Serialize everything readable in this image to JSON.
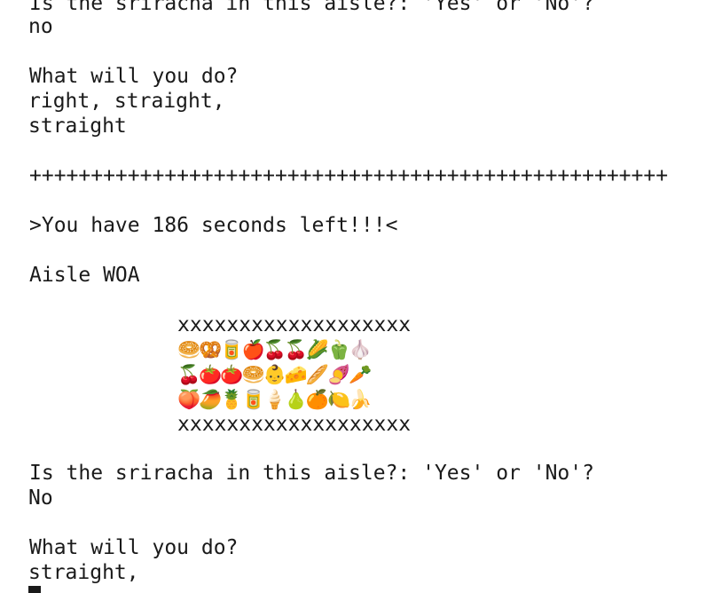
{
  "terminal": {
    "lines": {
      "prompt_prev": "Is the sriracha in this aisle?: 'Yes' or 'No'?",
      "answer_prev": "no",
      "ask_prev": "What will you do?",
      "move_prev_1": "right, straight,",
      "move_prev_2": "straight",
      "separator": "++++++++++++++++++++++++++++++++++++++++++++++++++++",
      "timer": ">You have 186 seconds left!!!<",
      "aisle_title": "Aisle WOA",
      "prompt": "Is the sriracha in this aisle?: 'Yes' or 'No'?",
      "answer": "No",
      "ask": "What will you do?",
      "move_current": "straight,"
    },
    "aisle": {
      "border_top": "xxxxxxxxxxxxxxxxxxx",
      "row1": "🥯🥨🥫🍎🍒🍒🌽🫑🧄",
      "row2": "🍒🍅🍅🥯👶🧀🥖🍠🥕",
      "row3": "🍑🥭🍍🥫🍦🍐🍊🍋🍌",
      "border_bottom": "xxxxxxxxxxxxxxxxxxx"
    }
  }
}
